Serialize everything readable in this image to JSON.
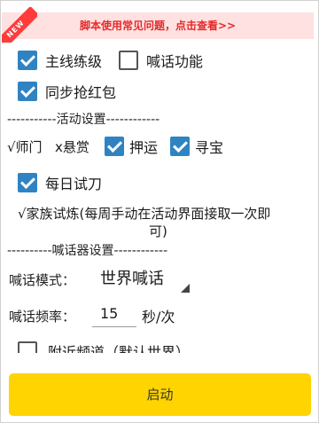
{
  "banner": {
    "ribbon": "NEW",
    "text": "脚本使用常见问题，点击查看>>"
  },
  "options": {
    "main_quest": {
      "label": "主线练级",
      "checked": true
    },
    "shout": {
      "label": "喊话功能",
      "checked": false
    },
    "sync_red_packet": {
      "label": "同步抢红包",
      "checked": true
    }
  },
  "activity": {
    "divider": "-----------活动设置------------",
    "master_label": "√师门",
    "bounty_label": "x悬赏",
    "escort": {
      "label": "押运",
      "checked": true
    },
    "treasure": {
      "label": "寻宝",
      "checked": true
    },
    "daily_blade": {
      "label": "每日试刀",
      "checked": true
    },
    "family_trial_line1": "√家族试炼(每周手动在活动界面接取一次即",
    "family_trial_line2": "可)"
  },
  "shouter": {
    "divider": "----------喊话器设置------------",
    "mode_label": "喊话模式：",
    "mode_value": "世界喊话",
    "freq_label": "喊话频率：",
    "freq_value": "15",
    "freq_unit": "秒/次",
    "nearby_label": "附近频道（默认世界）"
  },
  "start_button": "启动"
}
